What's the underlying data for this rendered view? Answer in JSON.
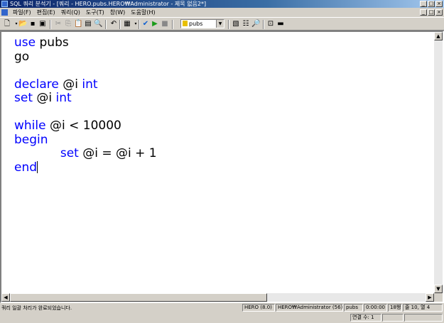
{
  "window": {
    "title": "SQL 쿼리 분석기 - [쿼리 - HERO.pubs.HERO₩Administrator - 제목 없음2*]",
    "buttons": [
      "_",
      "□",
      "×"
    ]
  },
  "menu": {
    "items": [
      "파일(F)",
      "편집(E)",
      "쿼리(Q)",
      "도구(T)",
      "창(W)",
      "도움말(H)"
    ],
    "mdi_buttons": [
      "_",
      "□",
      "×"
    ]
  },
  "toolbar": {
    "database": "pubs"
  },
  "editor": {
    "lines": [
      [
        {
          "t": "use",
          "k": true
        },
        {
          "t": " pubs",
          "k": false
        }
      ],
      [
        {
          "t": "go",
          "k": false
        }
      ],
      [],
      [
        {
          "t": "declare",
          "k": true
        },
        {
          "t": " @i ",
          "k": false
        },
        {
          "t": "int",
          "k": true
        }
      ],
      [
        {
          "t": "set",
          "k": true
        },
        {
          "t": " @i ",
          "k": false
        },
        {
          "t": "int",
          "k": true
        }
      ],
      [],
      [
        {
          "t": "while",
          "k": true
        },
        {
          "t": " @i < 10000",
          "k": false
        }
      ],
      [
        {
          "t": "begin",
          "k": true
        }
      ],
      [
        {
          "t": "            ",
          "k": false
        },
        {
          "t": "set",
          "k": true
        },
        {
          "t": " @i = @i + 1",
          "k": false
        }
      ],
      [
        {
          "t": "end",
          "k": true
        }
      ]
    ]
  },
  "status": {
    "message": "쿼리 일괄 처리가 완료되었습니다.",
    "server": "HERO (8.0)",
    "user": "HERO₩Administrator (56)",
    "db": "pubs",
    "time": "0:00:00",
    "rows": "18행",
    "position": "줄 10, 열 4",
    "connections": "연결 수: 1"
  },
  "colors": {
    "keyword": "#0000ff",
    "titlebar": "#0a246a"
  }
}
